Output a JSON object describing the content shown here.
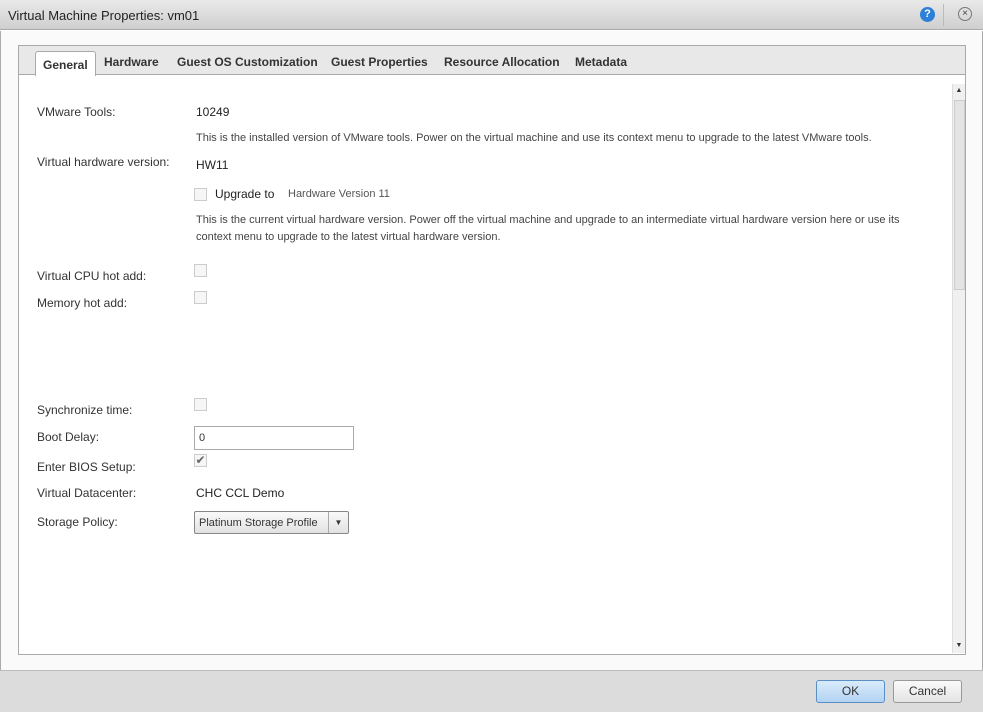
{
  "window": {
    "title": "Virtual Machine Properties: vm01",
    "help_icon": "?",
    "close_icon": "×"
  },
  "tabs": [
    {
      "label": "General",
      "active": true
    },
    {
      "label": "Hardware"
    },
    {
      "label": "Guest OS Customization"
    },
    {
      "label": "Guest Properties"
    },
    {
      "label": "Resource Allocation"
    },
    {
      "label": "Metadata"
    }
  ],
  "general": {
    "vmware_tools_label": "VMware Tools:",
    "vmware_tools_value": "10249",
    "vmware_tools_desc": "This is the installed version of VMware tools. Power on the virtual machine and use its context menu to upgrade to the latest VMware tools.",
    "hw_version_label": "Virtual hardware version:",
    "hw_version_value": "HW11",
    "upgrade_label": "Upgrade to",
    "upgrade_value": "Hardware Version 11",
    "upgrade_checked": false,
    "hw_desc": "This is the current virtual hardware version. Power off the virtual machine and upgrade to an intermediate virtual hardware version here or use its context menu to upgrade to the latest virtual hardware version.",
    "cpu_hot_add_label": "Virtual CPU hot add:",
    "cpu_hot_add_checked": false,
    "mem_hot_add_label": "Memory hot add:",
    "mem_hot_add_checked": false,
    "sync_time_label": "Synchronize time:",
    "sync_time_checked": false,
    "boot_delay_label": "Boot Delay:",
    "boot_delay_value": "0",
    "bios_label": "Enter BIOS Setup:",
    "bios_checked": true,
    "check_mark": "✔",
    "vdc_label": "Virtual Datacenter:",
    "vdc_value": "CHC CCL Demo",
    "storage_label": "Storage Policy:",
    "storage_value": "Platinum Storage Profile"
  },
  "footer": {
    "ok": "OK",
    "cancel": "Cancel"
  }
}
